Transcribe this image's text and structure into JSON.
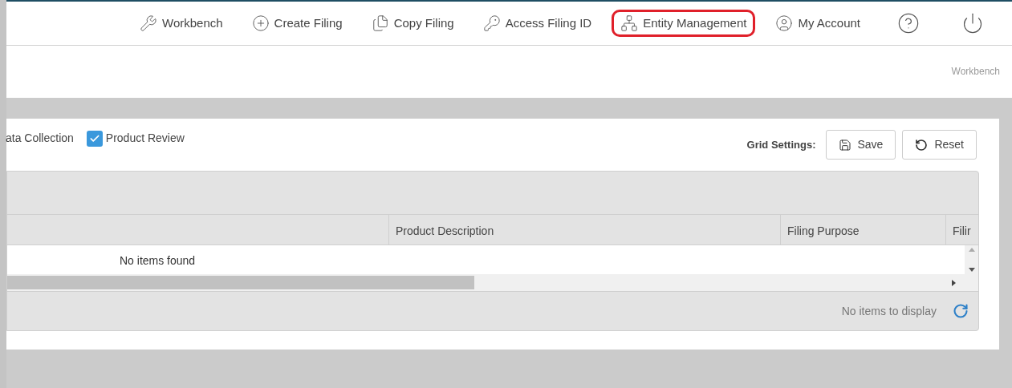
{
  "nav": [
    {
      "kind": "workbench",
      "label": "Workbench",
      "highlighted": false
    },
    {
      "kind": "create",
      "label": "Create Filing",
      "highlighted": false
    },
    {
      "kind": "copy",
      "label": "Copy Filing",
      "highlighted": false
    },
    {
      "kind": "access",
      "label": "Access Filing ID",
      "highlighted": false
    },
    {
      "kind": "entity",
      "label": "Entity Management",
      "highlighted": true
    },
    {
      "kind": "account",
      "label": "My Account",
      "highlighted": false
    },
    {
      "kind": "help",
      "highlighted": false
    },
    {
      "kind": "power",
      "highlighted": false
    }
  ],
  "breadcrumb": "Workbench",
  "filters": [
    {
      "kind": "label",
      "label": "ata Collection"
    },
    {
      "kind": "checkbox",
      "label": "Product Review",
      "checked": true
    }
  ],
  "grid_settings": {
    "label": "Grid Settings:",
    "buttons": [
      {
        "kind": "save",
        "label": "Save"
      },
      {
        "kind": "reset",
        "label": "Reset"
      }
    ]
  },
  "grid": {
    "columns": [
      "",
      "Product Description",
      "Filing Purpose",
      "Filir"
    ],
    "empty_message": "No items found",
    "footer": "No items to display"
  }
}
